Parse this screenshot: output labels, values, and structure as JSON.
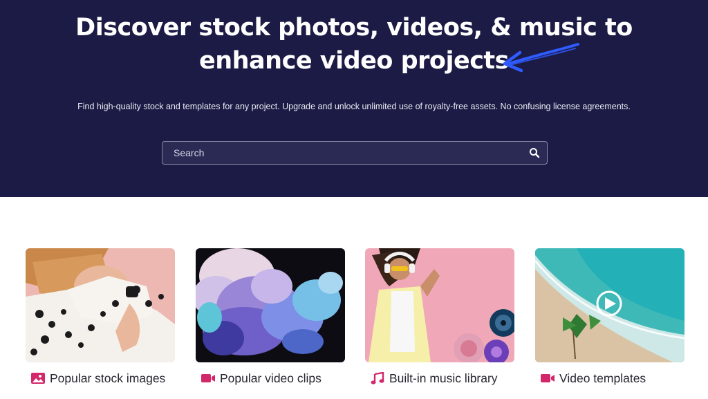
{
  "hero": {
    "title_line1": "Discover stock photos, videos, & music to",
    "title_line2": "enhance video projects",
    "subtitle": "Find high-quality stock and templates for any project. Upgrade and unlock unlimited use of royalty-free assets. No confusing license agreements.",
    "bg_color": "#1b1b45",
    "arrow_color": "#2f5bff"
  },
  "search": {
    "placeholder": "Search",
    "value": "",
    "icon": "search-icon"
  },
  "categories": [
    {
      "label": "Popular stock images",
      "icon": "image-icon"
    },
    {
      "label": "Popular video clips",
      "icon": "video-camera-icon"
    },
    {
      "label": "Built-in music library",
      "icon": "music-note-icon"
    },
    {
      "label": "Video templates",
      "icon": "video-camera-icon"
    }
  ],
  "accent_color": "#d2276a"
}
